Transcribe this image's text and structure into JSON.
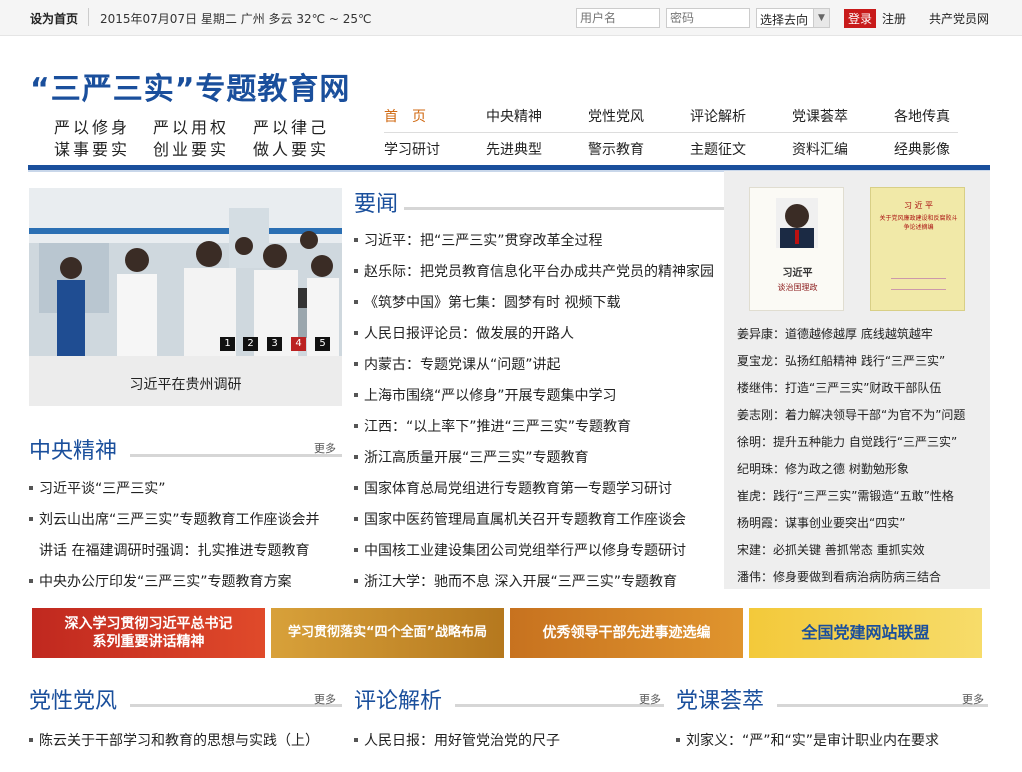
{
  "topbar": {
    "home_label": "设为首页",
    "date_weather": "2015年07月07日 星期二 广州 多云 32℃ ~ 25℃",
    "username_placeholder": "用户名",
    "password_placeholder": "密码",
    "select_value": "选择去向",
    "login_label": "登录",
    "register_label": "注册",
    "party_net_label": "共产党员网"
  },
  "header": {
    "logo": "“三严三实”专题教育网",
    "motto": [
      "严以修身",
      "严以用权",
      "严以律己",
      "谋事要实",
      "创业要实",
      "做人要实"
    ]
  },
  "nav": {
    "row1": [
      "首　页",
      "中央精神",
      "党性党风",
      "评论解析",
      "党课荟萃",
      "各地传真"
    ],
    "row2": [
      "学习研讨",
      "先进典型",
      "警示教育",
      "主题征文",
      "资料汇编",
      "经典影像"
    ]
  },
  "photo": {
    "caption": "习近平在贵州调研",
    "pager": [
      "1",
      "2",
      "3",
      "4",
      "5"
    ],
    "active_page": 4
  },
  "news": {
    "title": "要闻",
    "items": [
      "习近平：把“三严三实”贯穿改革全过程",
      "赵乐际：把党员教育信息化平台办成共产党员的精神家园",
      "《筑梦中国》第七集：圆梦有时 视频下载",
      "人民日报评论员：做发展的开路人",
      "内蒙古：专题党课从“问题”讲起",
      "上海市围绕“严以修身”开展专题集中学习",
      "江西：“以上率下”推进“三严三实”专题教育",
      "浙江高质量开展“三严三实”专题教育",
      "国家体育总局党组进行专题教育第一专题学习研讨",
      "国家中医药管理局直属机关召开专题教育工作座谈会",
      "中国核工业建设集团公司党组举行严以修身专题研讨",
      "浙江大学：驰而不息 深入开展“三严三实”专题教育"
    ]
  },
  "central": {
    "title": "中央精神",
    "more": "更多",
    "items": [
      "习近平谈“三严三实”",
      "刘云山出席“三严三实”专题教育工作座谈会并",
      "讲话 在福建调研时强调：扎实推进专题教育",
      "中央办公厅印发“三严三实”专题教育方案"
    ]
  },
  "rightbox": {
    "book1_author": "习近平",
    "book1_title": "谈治国理政",
    "book2_author": "习 近 平",
    "book2_title": "关于党风廉政建设和反腐败斗争论述摘编",
    "items": [
      "姜异康：道德越修越厚 底线越筑越牢",
      "夏宝龙：弘扬红船精神 践行“三严三实”",
      "楼继伟：打造“三严三实”财政干部队伍",
      "姜志刚：着力解决领导干部“为官不为”问题",
      "徐明：提升五种能力 自觉践行“三严三实”",
      "纪明珠：修为政之德 树勤勉形象",
      "崔虎：践行“三严三实”需锻造“五敢”性格",
      "杨明霞：谋事创业要突出“四实”",
      "宋建：必抓关键 善抓常态 重抓实效",
      "潘伟：修身要做到看病治病防病三结合"
    ]
  },
  "banners": [
    "深入学习贯彻习近平总书记\n系列重要讲话精神",
    "学习贯彻落实“四个全面”战略布局",
    "优秀领导干部先进事迹选编",
    "全国党建网站联盟"
  ],
  "bottom": {
    "sec1_title": "党性党风",
    "sec1_item": "陈云关于干部学习和教育的思想与实践（上）",
    "sec2_title": "评论解析",
    "sec2_item": "人民日报：用好管党治党的尺子",
    "sec3_title": "党课荟萃",
    "sec3_item": "刘家义：“严”和“实”是审计职业内在要求",
    "more": "更多"
  },
  "colors": {
    "brand_blue": "#1a4f9c",
    "login_red": "#c81a1a",
    "nav_active": "#d06a13"
  }
}
